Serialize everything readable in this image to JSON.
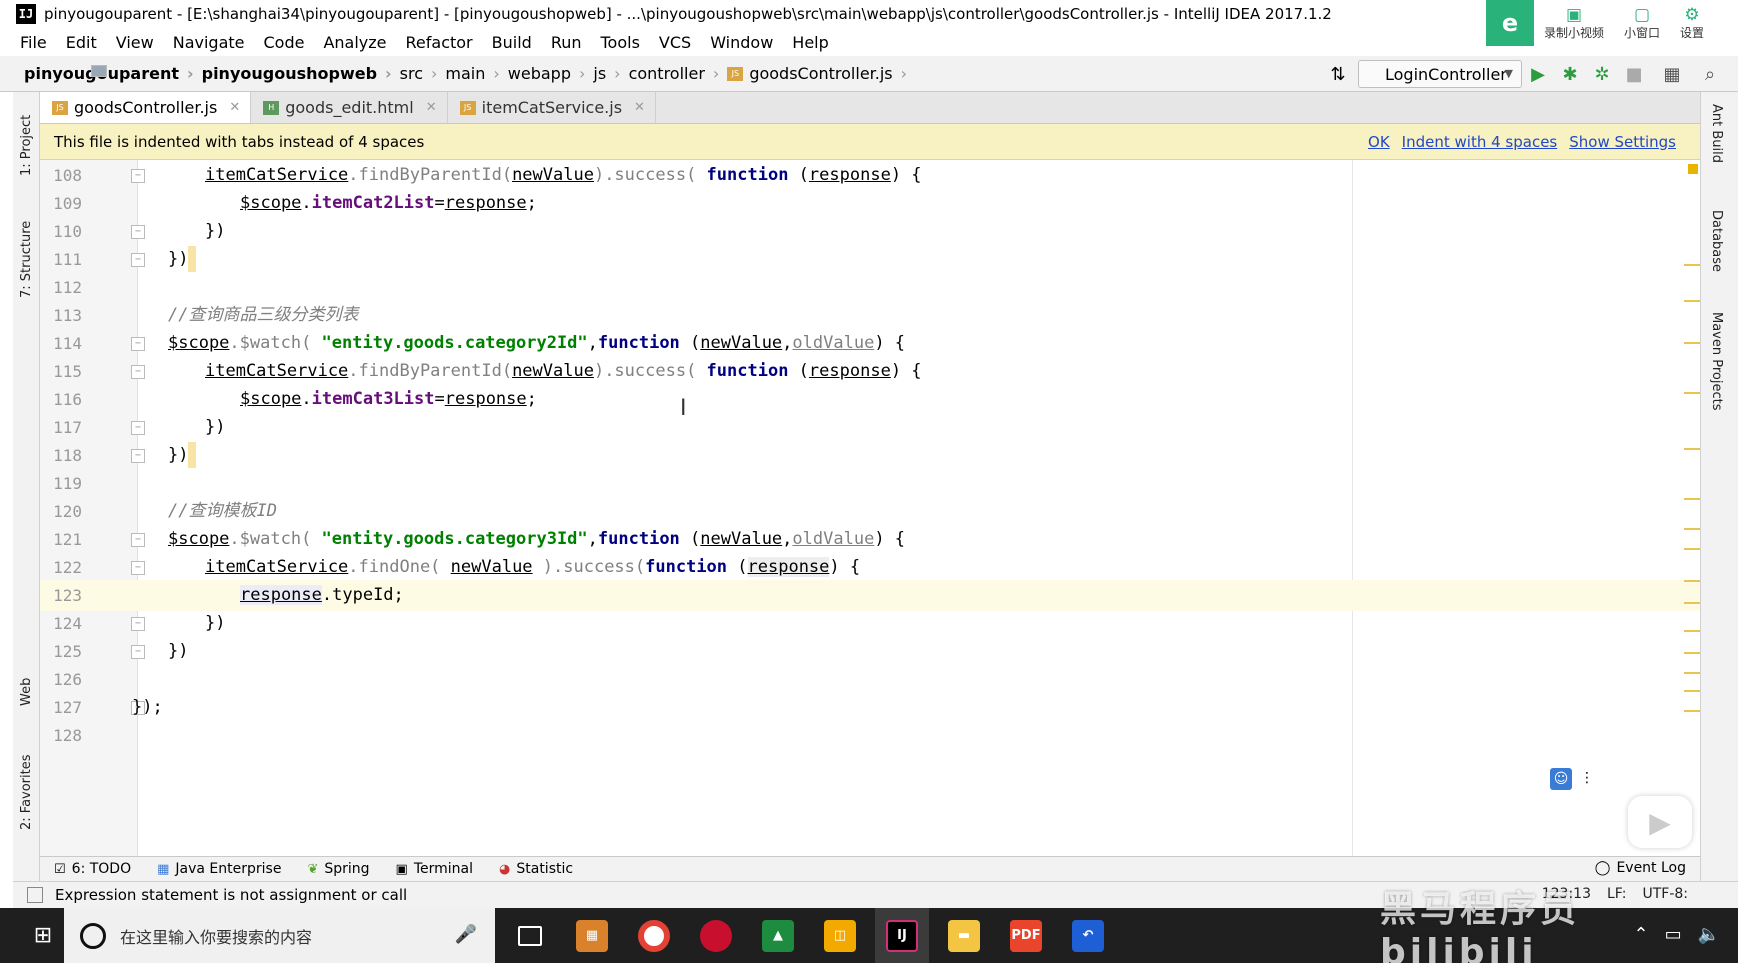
{
  "window": {
    "title": "pinyougouparent - [E:\\shanghai34\\pinyougouparent] - [pinyougoushopweb] - ...\\pinyougoushopweb\\src\\main\\webapp\\js\\controller\\goodsController.js - IntelliJ IDEA 2017.1.2"
  },
  "recorder": {
    "btn1": "录制小视频",
    "btn2": "小窗口",
    "btn3": "设置"
  },
  "menu": [
    "File",
    "Edit",
    "View",
    "Navigate",
    "Code",
    "Analyze",
    "Refactor",
    "Build",
    "Run",
    "Tools",
    "VCS",
    "Window",
    "Help"
  ],
  "breadcrumb": [
    "pinyougouparent",
    "pinyougoushopweb",
    "src",
    "main",
    "webapp",
    "js",
    "controller",
    "goodsController.js"
  ],
  "run_config": "LoginController",
  "tabs": [
    {
      "label": "goodsController.js",
      "active": true
    },
    {
      "label": "goods_edit.html",
      "active": false
    },
    {
      "label": "itemCatService.js",
      "active": false
    }
  ],
  "notice": {
    "text": "This file is indented with tabs instead of 4 spaces",
    "ok": "OK",
    "indent": "Indent with 4 spaces",
    "settings": "Show Settings"
  },
  "left_tools": [
    "1: Project",
    "7: Structure",
    "Web",
    "2: Favorites"
  ],
  "right_tools": [
    "Ant Build",
    "Database",
    "Maven Projects"
  ],
  "line_numbers": [
    "108",
    "109",
    "110",
    "111",
    "112",
    "113",
    "114",
    "115",
    "116",
    "117",
    "118",
    "119",
    "120",
    "121",
    "122",
    "123",
    "124",
    "125",
    "126",
    "127",
    "128"
  ],
  "code": {
    "l108_a": "itemCatService",
    "l108_b": ".findByParentId(",
    "l108_c": "newValue",
    "l108_d": ").success( ",
    "l108_e": "function",
    "l108_f": " (",
    "l108_g": "response",
    "l108_h": ") {",
    "l109_a": "$scope",
    "l109_b": ".",
    "l109_c": "itemCat2List",
    "l109_d": "=",
    "l109_e": "response",
    "l109_f": ";",
    "l110": "})",
    "l111": "})",
    "l113": "//查询商品三级分类列表",
    "l114_a": "$scope",
    "l114_b": ".$watch( ",
    "l114_c": "\"entity.goods.category2Id\"",
    "l114_d": ",",
    "l114_e": "function",
    "l114_f": " (",
    "l114_g": "newValue",
    "l114_h": ",",
    "l114_i": "oldValue",
    "l114_j": ") {",
    "l115_a": "itemCatService",
    "l115_b": ".findByParentId(",
    "l115_c": "newValue",
    "l115_d": ").success( ",
    "l115_e": "function",
    "l115_f": " (",
    "l115_g": "response",
    "l115_h": ") {",
    "l116_a": "$scope",
    "l116_b": ".",
    "l116_c": "itemCat3List",
    "l116_d": "=",
    "l116_e": "response",
    "l116_f": ";",
    "l117": "})",
    "l118": "})",
    "l120_a": "//查询模板",
    "l120_b": "ID",
    "l121_a": "$scope",
    "l121_b": ".$watch( ",
    "l121_c": "\"entity.goods.category3Id\"",
    "l121_d": ",",
    "l121_e": "function",
    "l121_f": " (",
    "l121_g": "newValue",
    "l121_h": ",",
    "l121_i": "oldValue",
    "l121_j": ") {",
    "l122_a": "itemCatService",
    "l122_b": ".findOne( ",
    "l122_c": "newValue",
    "l122_d": " ).success(",
    "l122_e": "function",
    "l122_f": " (",
    "l122_g": "response",
    "l122_h": ") {",
    "l123_a": "response",
    "l123_b": ".typeId;",
    "l124": "})",
    "l125": "})",
    "l127": "});"
  },
  "bottom_tools": [
    "6: TODO",
    "Java Enterprise",
    "Spring",
    "Terminal",
    "Statistic"
  ],
  "event_log": "Event Log",
  "status": {
    "message": "Expression statement is not assignment or call",
    "position": "123:13",
    "line_sep": "LF:",
    "encoding": "UTF-8:"
  },
  "taskbar": {
    "search_placeholder": "在这里输入你要搜索的内容"
  },
  "watermark": "黑马程序员 bilibili"
}
